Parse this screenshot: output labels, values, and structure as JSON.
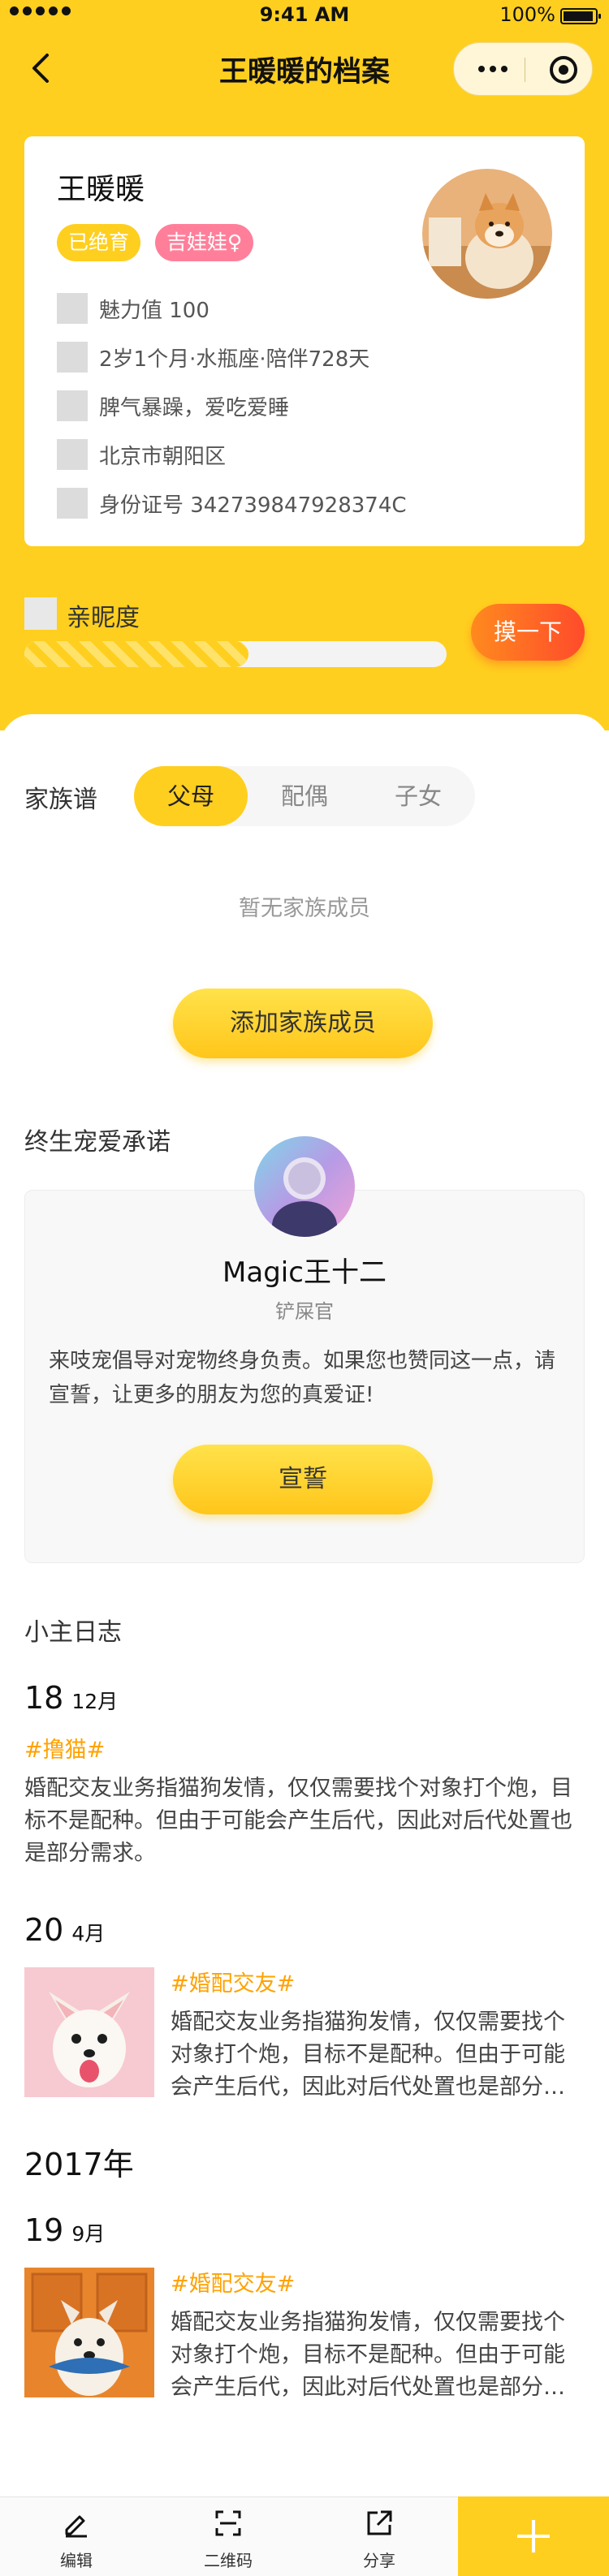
{
  "status_bar": {
    "time": "9:41 AM",
    "battery": "100%"
  },
  "nav": {
    "title": "王暖暖的档案"
  },
  "profile": {
    "name": "王暖暖",
    "tags": [
      "已绝育",
      "吉娃娃♀"
    ],
    "info": [
      "魅力值 100",
      "2岁1个月·水瓶座·陪伴728天",
      "脾气暴躁，爱吃爱睡",
      "北京市朝阳区",
      "身份证号 342739847928374C"
    ]
  },
  "intimacy": {
    "label": "亲昵度",
    "progress_fraction": 0.53,
    "shake_label": "摸一下"
  },
  "family": {
    "label": "家族谱",
    "tabs": [
      "父母",
      "配偶",
      "子女"
    ],
    "active_tab": 0,
    "empty_text": "暂无家族成员",
    "add_button": "添加家族成员"
  },
  "promise": {
    "title": "终生宠爱承诺",
    "name": "Magic王十二",
    "role": "铲屎官",
    "text": "来吱宠倡导对宠物终身负责。如果您也赞同这一点，请宣誓，让更多的朋友为您的真爱证!",
    "button": "宣誓"
  },
  "diary": {
    "title": "小主日志",
    "year_label": "2017年",
    "entries": [
      {
        "day": "18",
        "month": "12月",
        "tag": "#撸猫#",
        "text": "婚配交友业务指猫狗发情，仅仅需要找个对象打个炮，目标不是配种。但由于可能会产生后代，因此对后代处置也是部分需求。"
      },
      {
        "day": "20",
        "month": "4月",
        "tag": "#婚配交友#",
        "text": "婚配交友业务指猫狗发情，仅仅需要找个对象打个炮，目标不是配种。但由于可能会产生后代，因此对后代处置也是部分…"
      },
      {
        "day": "19",
        "month": "9月",
        "tag": "#婚配交友#",
        "text": "婚配交友业务指猫狗发情，仅仅需要找个对象打个炮，目标不是配种。但由于可能会产生后代，因此对后代处置也是部分…"
      }
    ]
  },
  "bottom_bar": {
    "items": [
      "编辑",
      "二维码",
      "分享"
    ]
  },
  "colors": {
    "brand_yellow": "#FFCF1F",
    "accent_orange": "#FFA200",
    "shake_red": "#FF4B2B",
    "tag_pink": "#FF7F9A"
  }
}
